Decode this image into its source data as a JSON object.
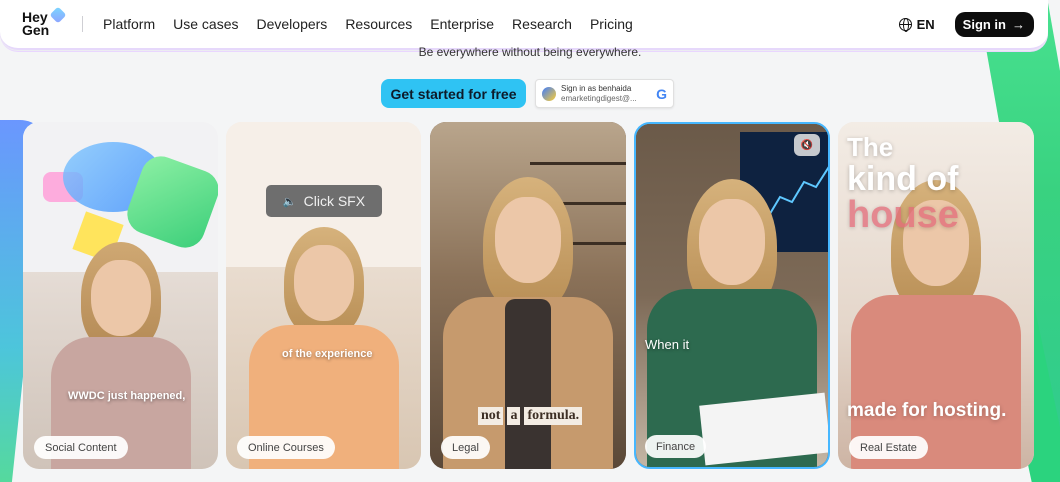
{
  "brand": {
    "line1": "Hey",
    "line2": "Gen"
  },
  "nav": {
    "links": [
      "Platform",
      "Use cases",
      "Developers",
      "Resources",
      "Enterprise",
      "Research",
      "Pricing"
    ],
    "lang": "EN",
    "signin": "Sign in",
    "signin_arrow": "→"
  },
  "hero": {
    "tagline": "Be everywhere without being everywhere.",
    "cta": "Get started for free",
    "google": {
      "title": "Sign in as benhaida",
      "email": "emarketingdigest@...",
      "logo": "G"
    }
  },
  "cards": [
    {
      "label": "Social Content",
      "caption": "WWDC just happened,"
    },
    {
      "label": "Online Courses",
      "caption": "of the experience",
      "sfx": "Click SFX"
    },
    {
      "label": "Legal",
      "caption_words": [
        "not",
        "a",
        "formula."
      ]
    },
    {
      "label": "Finance",
      "caption": "When it"
    },
    {
      "label": "Real Estate",
      "caption_top1": "The",
      "caption_top2": "kind of",
      "caption_top3": "house",
      "caption_bottom": "made for hosting."
    }
  ],
  "colors": {
    "cta": "#2fc3f3",
    "signin_bg": "#0d0d0d",
    "accent_border": "#46b7ff"
  }
}
